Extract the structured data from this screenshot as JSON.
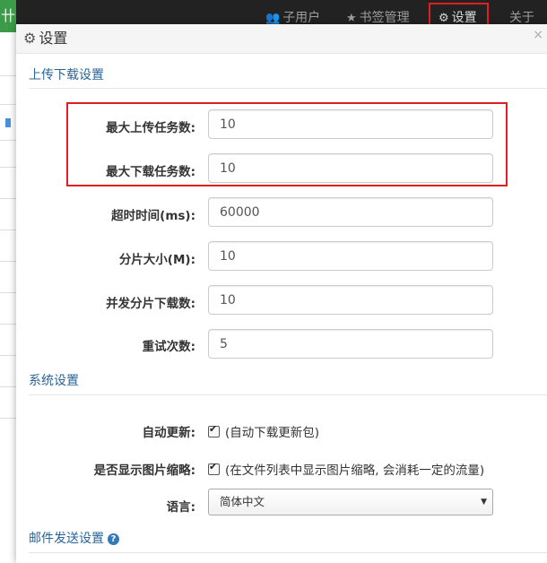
{
  "navbar": {
    "brand_partial": "卄",
    "items": [
      {
        "icon": "users-icon",
        "glyph": "👥",
        "label": "子用户"
      },
      {
        "icon": "star-icon",
        "glyph": "★",
        "label": "书签管理"
      },
      {
        "icon": "gear-icon",
        "glyph": "⚙",
        "label": "设置"
      },
      {
        "label": "关于"
      }
    ]
  },
  "modal": {
    "title_icon": "gear-icon",
    "title": "设置",
    "close_icon": "close-icon",
    "close_glyph": "×"
  },
  "transfer_section": {
    "title": "上传下载设置",
    "fields": [
      {
        "label": "最大上传任务数:",
        "value": "10"
      },
      {
        "label": "最大下载任务数:",
        "value": "10"
      },
      {
        "label": "超时时间(ms):",
        "value": "60000"
      },
      {
        "label": "分片大小(M):",
        "value": "10"
      },
      {
        "label": "并发分片下载数:",
        "value": "10"
      },
      {
        "label": "重试次数:",
        "value": "5"
      }
    ]
  },
  "system_section": {
    "title": "系统设置",
    "auto_update": {
      "label": "自动更新:",
      "checked": true,
      "text": "(自动下载更新包)"
    },
    "thumbnail": {
      "label": "是否显示图片缩略:",
      "checked": true,
      "text": "(在文件列表中显示图片缩略, 会消耗一定的流量)"
    },
    "language": {
      "label": "语言:",
      "selected": "简体中文"
    }
  },
  "mail_section": {
    "title": "邮件发送设置",
    "help_icon": "help-icon"
  },
  "colors": {
    "accent_link": "#2a6496",
    "highlight_red": "#e02020",
    "navbar_bg": "#222222"
  }
}
